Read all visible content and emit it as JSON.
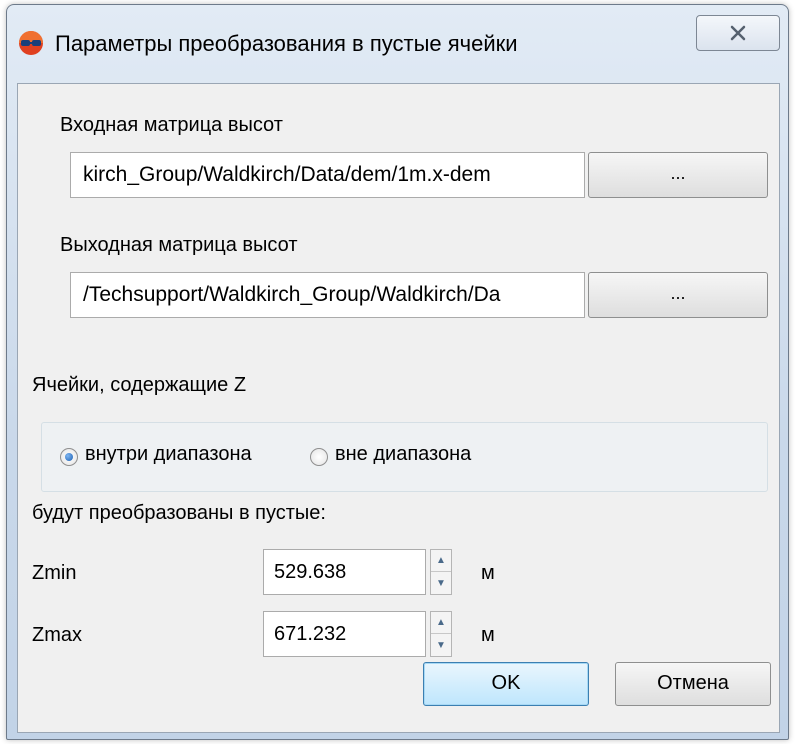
{
  "window": {
    "title": "Параметры преобразования в пустые ячейки",
    "close_symbol": "☒"
  },
  "input_dem": {
    "label": "Входная матрица высот",
    "value": "kirch_Group/Waldkirch/Data/dem/1m.x-dem",
    "browse_label": "..."
  },
  "output_dem": {
    "label": "Выходная матрица высот",
    "value": "/Techsupport/Waldkirch_Group/Waldkirch/Da",
    "browse_label": "..."
  },
  "cells": {
    "label": "Ячейки, содержащие Z",
    "options": [
      {
        "label": "внутри диапазона",
        "checked": true
      },
      {
        "label": "вне диапазона",
        "checked": false
      }
    ],
    "after_label": "будут преобразованы в пустые:"
  },
  "zmin": {
    "label": "Zmin",
    "value": "529.638",
    "unit": "м"
  },
  "zmax": {
    "label": "Zmax",
    "value": "671.232",
    "unit": "м"
  },
  "buttons": {
    "ok": "OK",
    "cancel": "Отмена"
  },
  "icons": {
    "app": "app-logo-icon",
    "close": "close-icon",
    "spin_up": "spin-up-icon",
    "spin_down": "spin-down-icon"
  }
}
